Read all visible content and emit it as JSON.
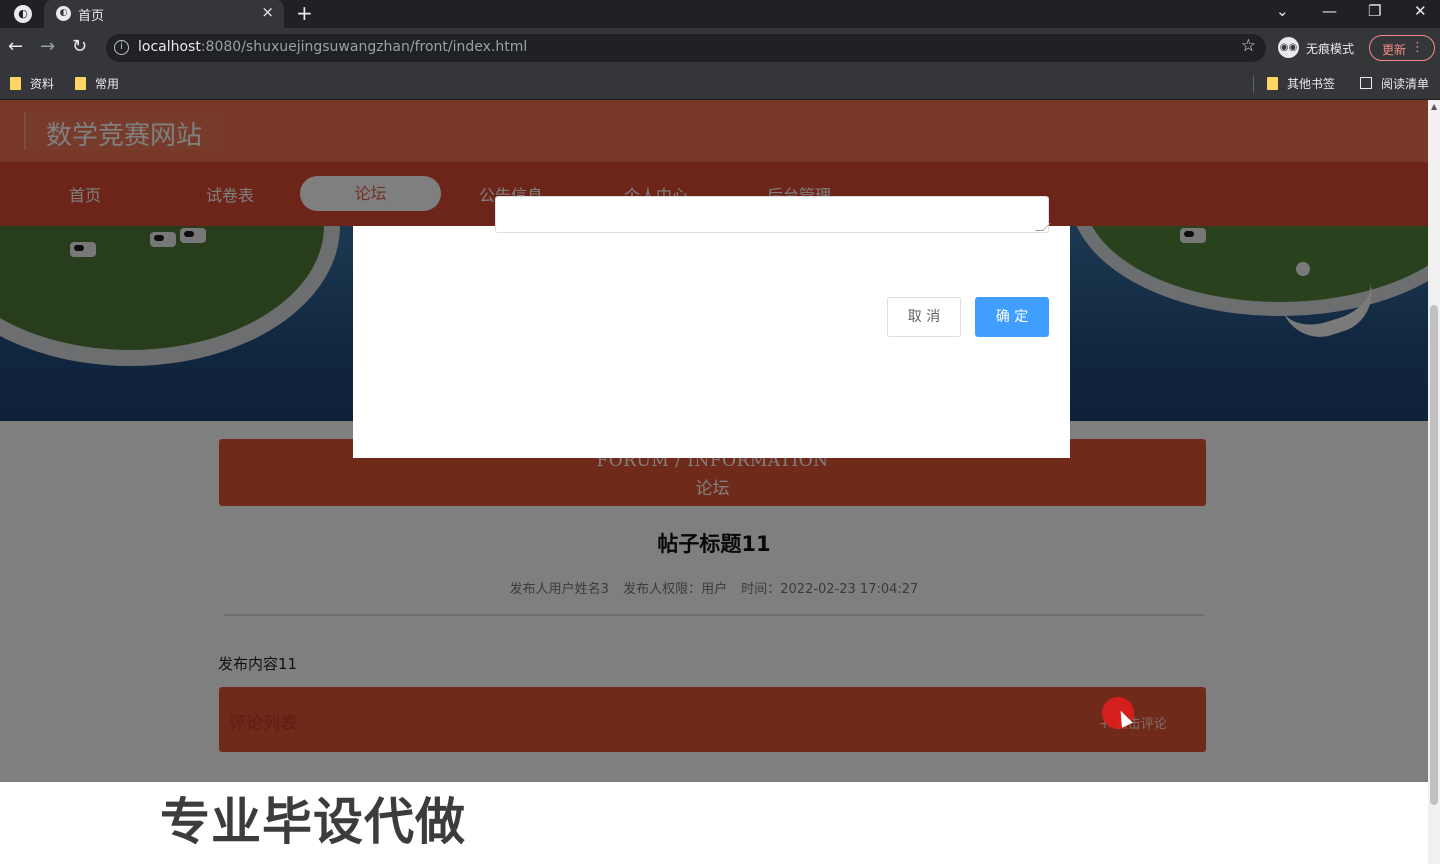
{
  "browser": {
    "tab_title": "首页",
    "tab_close": "×",
    "new_tab": "+",
    "url_host": "localhost",
    "url_rest": ":8080/shuxuejingsuwangzhan/front/index.html",
    "incognito_label": "无痕模式",
    "update_label": "更新",
    "bookmarks": [
      "资料",
      "常用"
    ],
    "other_bookmarks": "其他书签",
    "reading_list": "阅读清单",
    "icons": {
      "back": "back-arrow-icon",
      "forward": "forward-arrow-icon",
      "reload": "reload-icon",
      "info": "info-icon",
      "star": "star-icon",
      "menu": "more-vertical-icon"
    }
  },
  "site": {
    "title": "数学竞赛网站",
    "nav": [
      "首页",
      "试卷表",
      "论坛",
      "公告信息",
      "个人中心",
      "后台管理"
    ],
    "active_nav": "论坛",
    "carousel": {
      "count": 3,
      "active_index": 0
    },
    "colors": {
      "brand_bar": "#ee7050",
      "nav_bar": "#da4b34",
      "accent": "#e05434",
      "confirm_button": "#409eff"
    }
  },
  "forum": {
    "banner_en": "FORUM / INFORMATION",
    "banner_cn": "论坛",
    "post_title": "帖子标题11",
    "author": "发布人用户姓名3",
    "role": "发布人权限：用户",
    "time": "时间：2022-02-23 17:04:27",
    "content": "发布内容11",
    "comments_title": "评论列表",
    "comment_button": "点击评论"
  },
  "dialog": {
    "cancel": "取 消",
    "confirm": "确 定"
  },
  "watermark": "专业毕设代做"
}
